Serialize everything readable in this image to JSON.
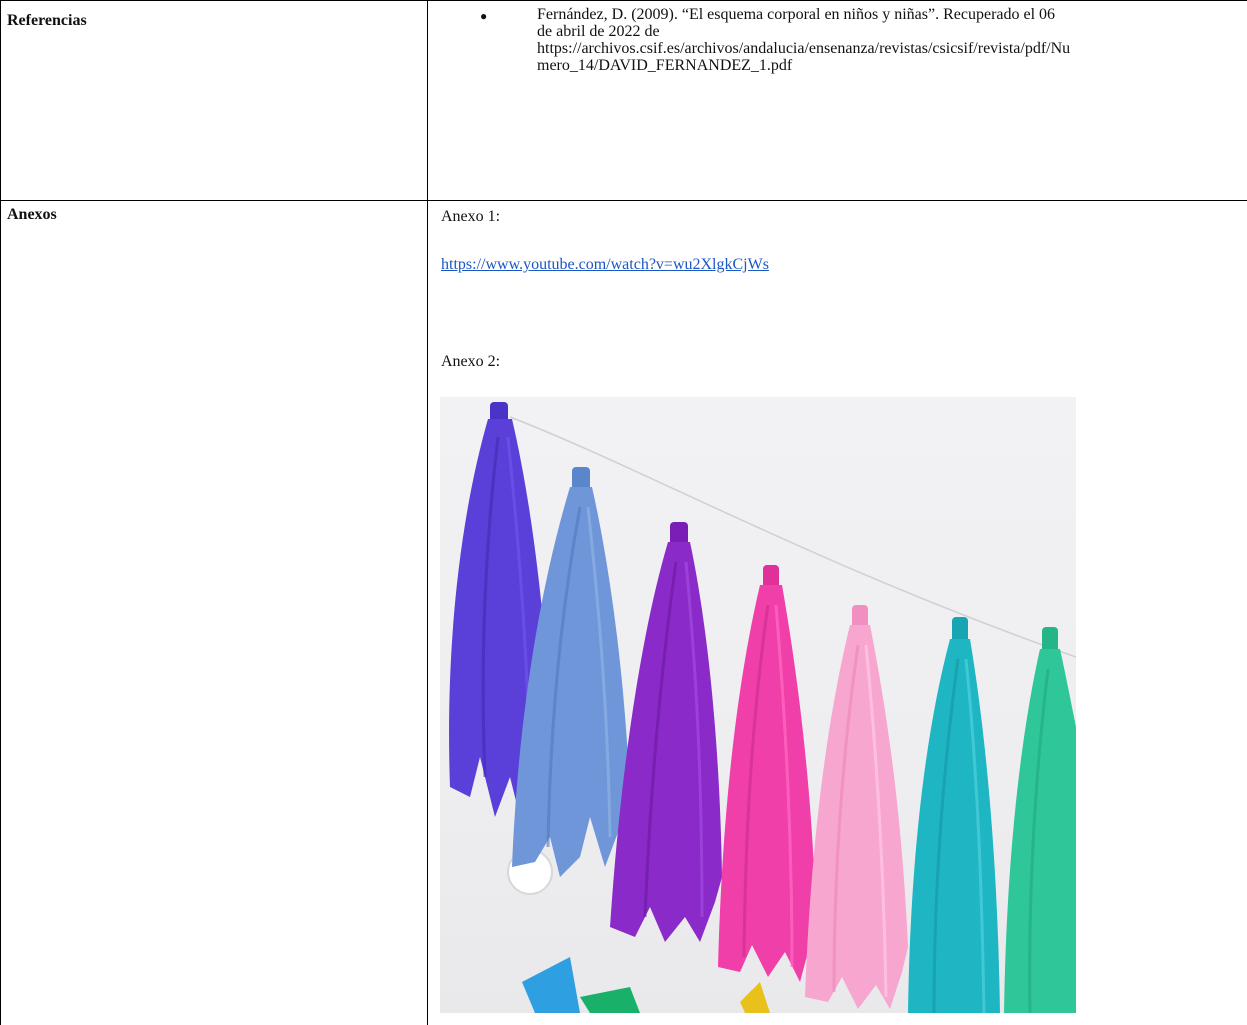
{
  "rows": {
    "references": {
      "label": "Referencias",
      "bullet": "●",
      "entry": "Fernández, D. (2009). “El esquema corporal en niños y niñas”. Recuperado el 06\nde abril de 2022 de\nhttps://archivos.csif.es/archivos/andalucia/ensenanza/revistas/csicsif/revista/pdf/Nu\nmero_14/DAVID_FERNANDEZ_1.pdf"
    },
    "annexes": {
      "label": "Anexos",
      "annex1_title": "Anexo 1:",
      "annex1_link": "https://www.youtube.com/watch?v=wu2XlgkCjWs",
      "annex2_title": "Anexo 2:",
      "annex2_image": "colorful-paper-tassel-garland"
    }
  },
  "colors": {
    "link": "#1a56c4",
    "tassels": [
      "#5a3fd8",
      "#6f96d8",
      "#8a2bc9",
      "#f03fa8",
      "#f7a6cf",
      "#1fb6c4",
      "#2fc79a"
    ]
  }
}
